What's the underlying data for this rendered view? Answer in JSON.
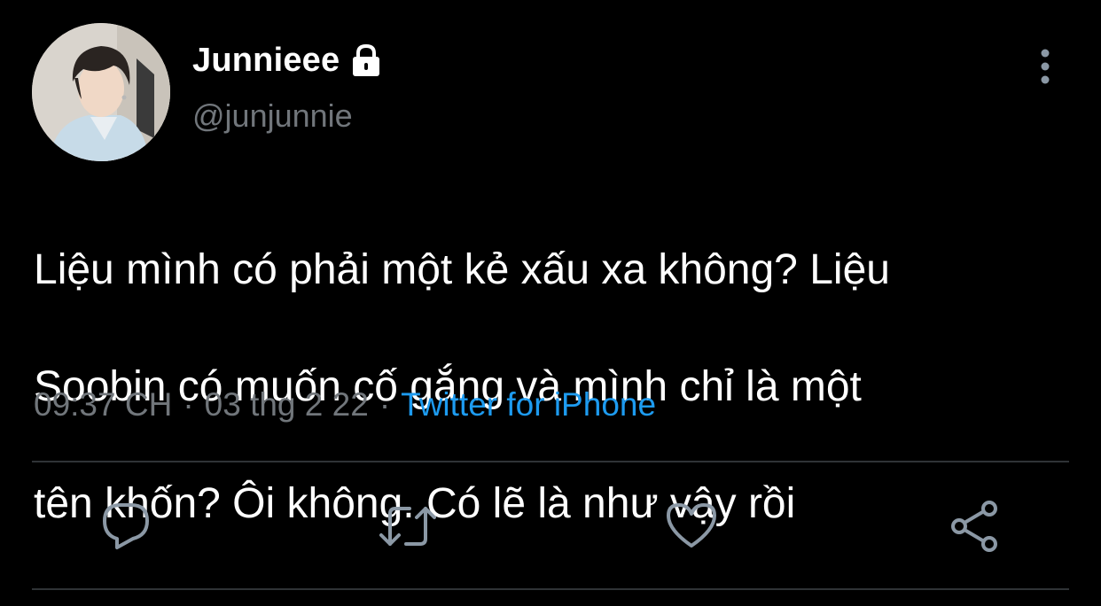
{
  "user": {
    "display_name": "Junnieee",
    "handle": "@junjunnie",
    "protected_icon": "lock-icon",
    "avatar_alt": "profile photo"
  },
  "tweet": {
    "lines": [
      "Liệu mình có phải một kẻ xấu xa không? Liệu",
      "Soobin có muốn cố gắng và mình chỉ là một",
      "tên khốn? Ôi không. Có lẽ là như vậy rồi"
    ],
    "time": "09:37 CH",
    "separator": "·",
    "date": "03 thg 2 22",
    "source": "Twitter for iPhone"
  },
  "actions": {
    "reply_icon": "reply-icon",
    "retweet_icon": "retweet-icon",
    "like_icon": "heart-icon",
    "share_icon": "share-icon",
    "more_icon": "more-vertical-icon"
  },
  "colors": {
    "background": "#000000",
    "text_primary": "#ffffff",
    "text_secondary": "#71767b",
    "accent": "#1d9bf0",
    "icon": "#8b98a5",
    "divider": "#2f3336"
  }
}
